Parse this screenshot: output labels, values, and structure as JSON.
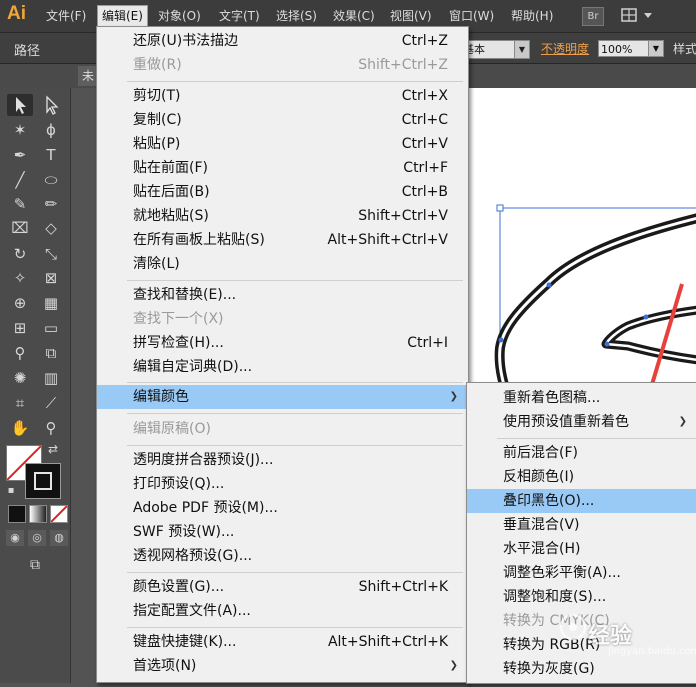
{
  "app": {
    "logo": "Ai"
  },
  "menubar": {
    "items": [
      "文件(F)",
      "编辑(E)",
      "对象(O)",
      "文字(T)",
      "选择(S)",
      "效果(C)",
      "视图(V)",
      "窗口(W)",
      "帮助(H)"
    ],
    "bridge_label": "Br"
  },
  "control_bar": {
    "object_type": "路径",
    "stroke_profile_value": "基本",
    "opacity_label": "不透明度",
    "opacity_value": "100%",
    "style_label": "样式"
  },
  "document": {
    "tab_label": "未"
  },
  "edit_menu": {
    "items": [
      {
        "label": "还原(U)书法描边",
        "shortcut": "Ctrl+Z",
        "disabled": false
      },
      {
        "label": "重做(R)",
        "shortcut": "Shift+Ctrl+Z",
        "disabled": true
      },
      {
        "label": "剪切(T)",
        "shortcut": "Ctrl+X",
        "disabled": false
      },
      {
        "label": "复制(C)",
        "shortcut": "Ctrl+C",
        "disabled": false
      },
      {
        "label": "粘贴(P)",
        "shortcut": "Ctrl+V",
        "disabled": false
      },
      {
        "label": "贴在前面(F)",
        "shortcut": "Ctrl+F",
        "disabled": false
      },
      {
        "label": "贴在后面(B)",
        "shortcut": "Ctrl+B",
        "disabled": false
      },
      {
        "label": "就地粘贴(S)",
        "shortcut": "Shift+Ctrl+V",
        "disabled": false
      },
      {
        "label": "在所有画板上粘贴(S)",
        "shortcut": "Alt+Shift+Ctrl+V",
        "disabled": false
      },
      {
        "label": "清除(L)",
        "shortcut": "",
        "disabled": false
      },
      {
        "label": "查找和替换(E)...",
        "shortcut": "",
        "disabled": false
      },
      {
        "label": "查找下一个(X)",
        "shortcut": "",
        "disabled": true
      },
      {
        "label": "拼写检查(H)...",
        "shortcut": "Ctrl+I",
        "disabled": false
      },
      {
        "label": "编辑自定词典(D)...",
        "shortcut": "",
        "disabled": false
      },
      {
        "label": "编辑颜色",
        "shortcut": "",
        "disabled": false,
        "highlighted": true,
        "submenu": true
      },
      {
        "label": "编辑原稿(O)",
        "shortcut": "",
        "disabled": true
      },
      {
        "label": "透明度拼合器预设(J)...",
        "shortcut": "",
        "disabled": false
      },
      {
        "label": "打印预设(Q)...",
        "shortcut": "",
        "disabled": false
      },
      {
        "label": "Adobe PDF 预设(M)...",
        "shortcut": "",
        "disabled": false
      },
      {
        "label": "SWF 预设(W)...",
        "shortcut": "",
        "disabled": false
      },
      {
        "label": "透视网格预设(G)...",
        "shortcut": "",
        "disabled": false
      },
      {
        "label": "颜色设置(G)...",
        "shortcut": "Shift+Ctrl+K",
        "disabled": false
      },
      {
        "label": "指定配置文件(A)...",
        "shortcut": "",
        "disabled": false
      },
      {
        "label": "键盘快捷键(K)...",
        "shortcut": "Alt+Shift+Ctrl+K",
        "disabled": false
      },
      {
        "label": "首选项(N)",
        "shortcut": "",
        "disabled": false,
        "submenu": true
      }
    ]
  },
  "edit_colors_submenu": {
    "items": [
      {
        "label": "重新着色图稿...",
        "disabled": false
      },
      {
        "label": "使用预设值重新着色",
        "disabled": false,
        "submenu": true
      },
      {
        "label": "前后混合(F)",
        "disabled": false
      },
      {
        "label": "反相颜色(I)",
        "disabled": false
      },
      {
        "label": "叠印黑色(O)...",
        "disabled": false,
        "highlighted": true
      },
      {
        "label": "垂直混合(V)",
        "disabled": false
      },
      {
        "label": "水平混合(H)",
        "disabled": false
      },
      {
        "label": "调整色彩平衡(A)...",
        "disabled": false
      },
      {
        "label": "调整饱和度(S)...",
        "disabled": false
      },
      {
        "label": "转换为 CMYK(C)",
        "disabled": true
      },
      {
        "label": "转换为 RGB(R)",
        "disabled": false
      },
      {
        "label": "转换为灰度(G)",
        "disabled": false
      }
    ]
  },
  "colors": {
    "highlight": "#99c9f5",
    "arrow": "#e8413c",
    "logo": "#f1a638",
    "selection": "#3f6fd6"
  },
  "watermark": {
    "text": "经验",
    "sub": "jingyan.baidu.com"
  }
}
